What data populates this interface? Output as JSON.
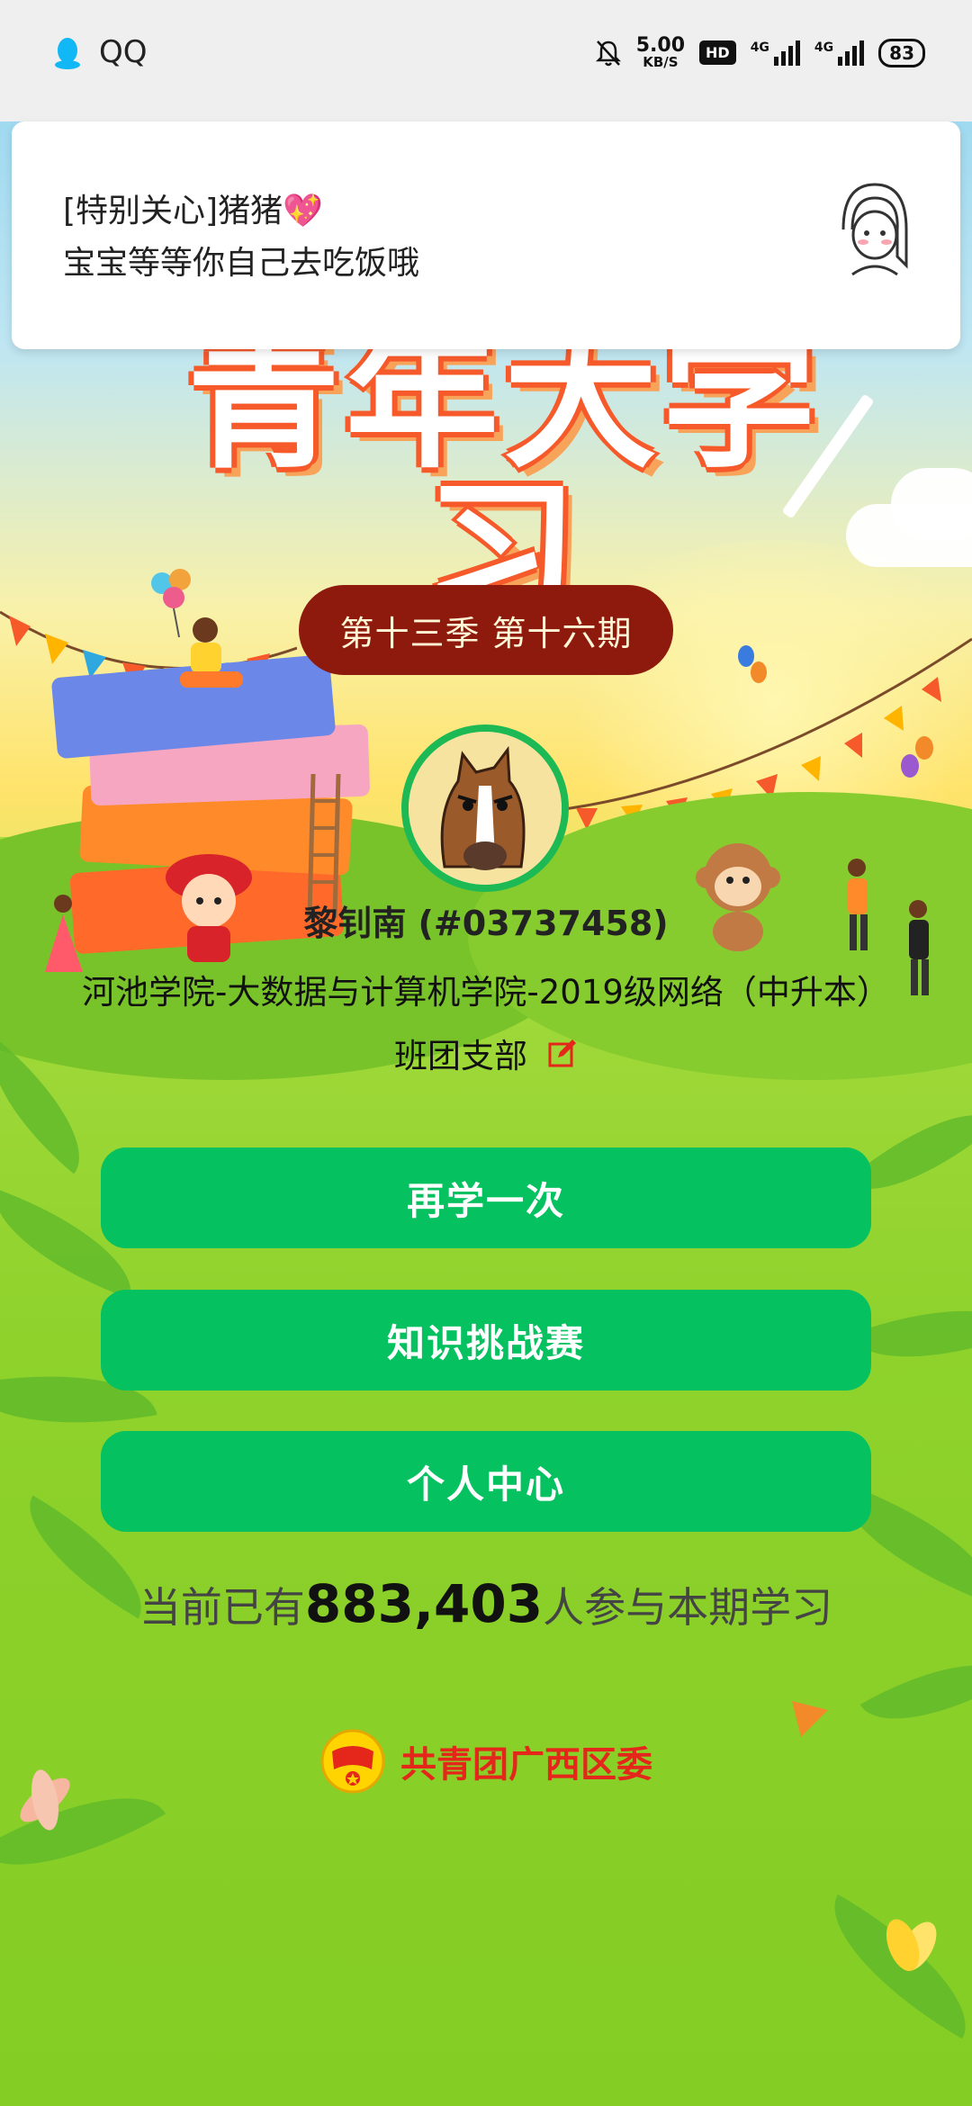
{
  "status_bar": {
    "app_name": "QQ",
    "speed_value": "5.00",
    "speed_unit": "KB/S",
    "hd_label": "HD",
    "net1": "4G",
    "net2": "4G",
    "battery": "83"
  },
  "notification": {
    "title": "[特别关心]猪猪💖",
    "body": "宝宝等等你自己去吃饭哦"
  },
  "main": {
    "season_label": "第十三季 第十六期",
    "user_name": "黎钊南 (#03737458)",
    "organization": "河池学院-大数据与计算机学院-2019级网络（中升本）",
    "branch": "班团支部"
  },
  "buttons": {
    "relearn": "再学一次",
    "quiz": "知识挑战赛",
    "profile": "个人中心"
  },
  "stats": {
    "prefix": "当前已有",
    "count": "883,403",
    "suffix": "人参与本期学习"
  },
  "footer": {
    "org_name": "共青团广西区委"
  },
  "colors": {
    "button_green": "#05c160",
    "season_bg": "#8e1a0e",
    "footer_red": "#e4261b"
  }
}
